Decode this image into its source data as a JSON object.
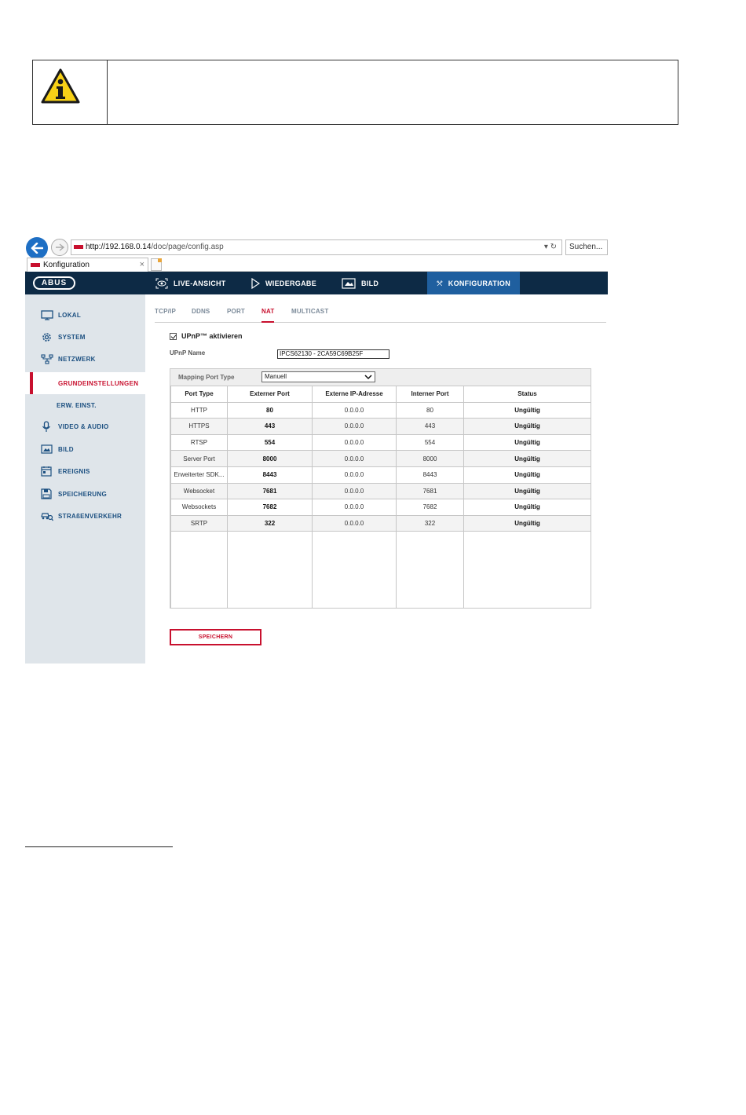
{
  "info_box": {
    "icon": "warning-info-icon"
  },
  "browser": {
    "url_host": "http://192.168.0.14",
    "url_path": "/doc/page/config.asp",
    "url_controls": "▾ ↻",
    "search_placeholder": "Suchen...",
    "tab_title": "Konfiguration",
    "tab_close": "×"
  },
  "header": {
    "logo": "ABUS",
    "nav": [
      {
        "label": "LIVE-ANSICHT",
        "icon": "eye-icon"
      },
      {
        "label": "WIEDERGABE",
        "icon": "play-icon"
      },
      {
        "label": "BILD",
        "icon": "image-icon"
      },
      {
        "label": "KONFIGURATION",
        "icon": "tools-icon",
        "active": true
      }
    ]
  },
  "sidebar": {
    "items": [
      {
        "label": "LOKAL",
        "icon": "monitor-icon"
      },
      {
        "label": "SYSTEM",
        "icon": "gear-icon"
      },
      {
        "label": "NETZWERK",
        "icon": "network-icon"
      },
      {
        "label": "GRUNDEINSTELLUNGEN",
        "active": true
      },
      {
        "label": "ERW. EINST."
      },
      {
        "label": "VIDEO & AUDIO",
        "icon": "microphone-icon"
      },
      {
        "label": "BILD",
        "icon": "image-icon"
      },
      {
        "label": "EREIGNIS",
        "icon": "calendar-icon"
      },
      {
        "label": "SPEICHERUNG",
        "icon": "save-icon"
      },
      {
        "label": "STRAßENVERKEHR",
        "icon": "car-search-icon"
      }
    ]
  },
  "subtabs": [
    "TCP/IP",
    "DDNS",
    "PORT",
    "NAT",
    "MULTICAST"
  ],
  "active_subtab": "NAT",
  "upnp": {
    "label": "UPnP™ aktivieren",
    "checked": true
  },
  "upnp_name": {
    "label": "UPnP Name",
    "value": "IPCS62130 - 2CA59C69B25F"
  },
  "mapping": {
    "label": "Mapping Port Type",
    "value": "Manuell"
  },
  "table": {
    "headers": [
      "Port Type",
      "Externer Port",
      "Externe IP-Adresse",
      "Interner Port",
      "Status"
    ],
    "rows": [
      [
        "HTTP",
        "80",
        "0.0.0.0",
        "80",
        "Ungültig"
      ],
      [
        "HTTPS",
        "443",
        "0.0.0.0",
        "443",
        "Ungültig"
      ],
      [
        "RTSP",
        "554",
        "0.0.0.0",
        "554",
        "Ungültig"
      ],
      [
        "Server Port",
        "8000",
        "0.0.0.0",
        "8000",
        "Ungültig"
      ],
      [
        "Erweiterter SDK...",
        "8443",
        "0.0.0.0",
        "8443",
        "Ungültig"
      ],
      [
        "Websocket",
        "7681",
        "0.0.0.0",
        "7681",
        "Ungültig"
      ],
      [
        "Websockets",
        "7682",
        "0.0.0.0",
        "7682",
        "Ungültig"
      ],
      [
        "SRTP",
        "322",
        "0.0.0.0",
        "322",
        "Ungültig"
      ]
    ]
  },
  "save_label": "SPEICHERN",
  "colors": {
    "header": "#0d2a45",
    "active_nav": "#1f5f9f",
    "accent": "#c8102e",
    "sidebar": "#dfe5ea",
    "link": "#1b4f80"
  }
}
